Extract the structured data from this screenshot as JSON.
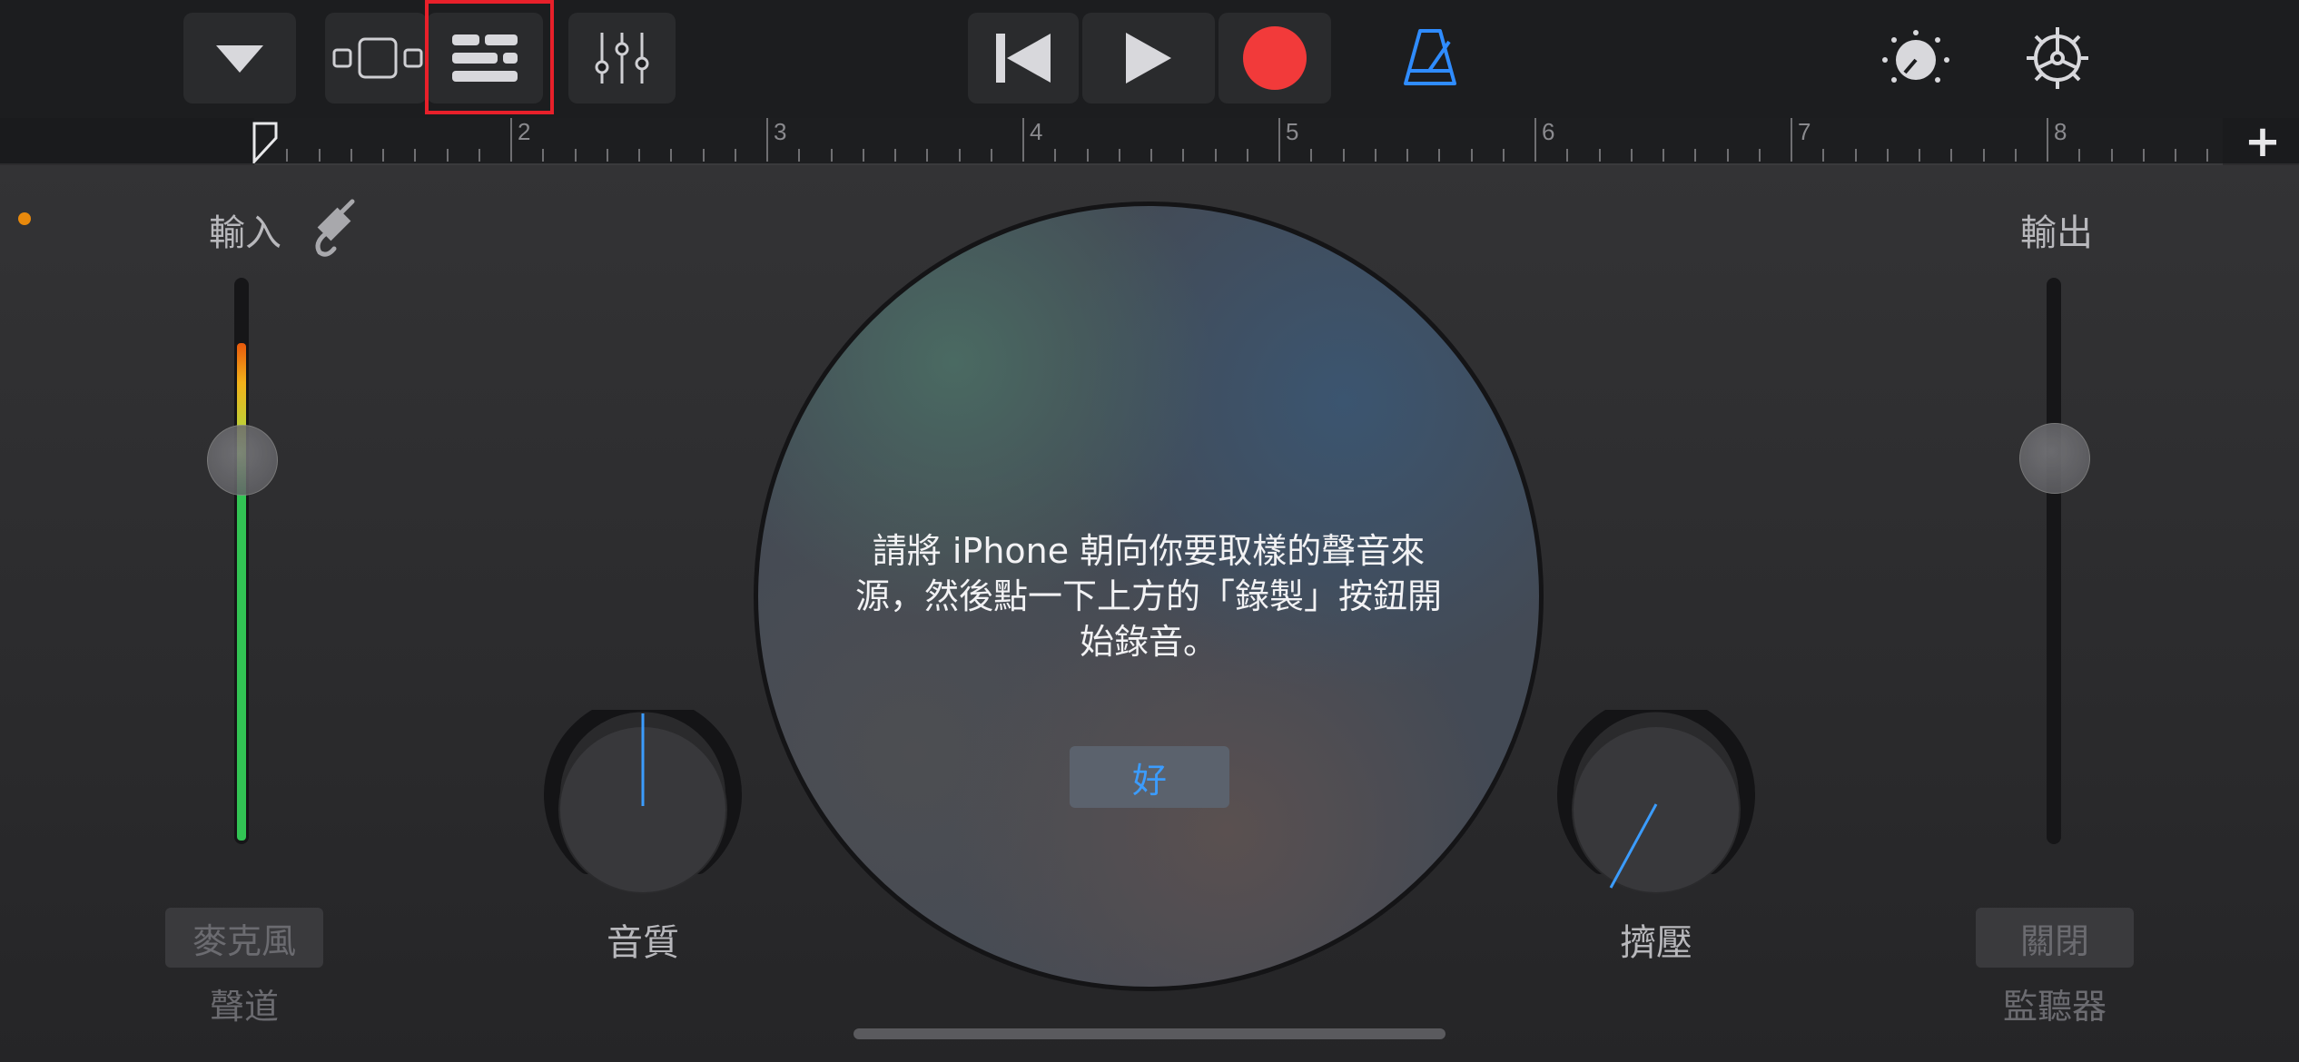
{
  "toolbar": {
    "icons": [
      "chevron-down-icon",
      "tracks-view-icon",
      "browser-view-icon",
      "mixer-icon",
      "rewind-icon",
      "play-icon",
      "record-icon",
      "metronome-icon",
      "master-knob-icon",
      "settings-gear-icon",
      "add-section-icon"
    ],
    "record_color": "#f23a3a",
    "metronome_color": "#2f8cff",
    "highlight_color": "#e8202a"
  },
  "ruler": {
    "bars": [
      "2",
      "3",
      "4",
      "5",
      "6",
      "7",
      "8"
    ],
    "add_label": "+"
  },
  "input": {
    "label": "輸入",
    "channel_button": "麥克風",
    "channel_caption": "聲道",
    "level_fraction": 0.89
  },
  "output": {
    "label": "輸出",
    "monitor_button": "關閉",
    "monitor_caption": "監聽器"
  },
  "knobs": {
    "quality_label": "音質",
    "compress_label": "擠壓"
  },
  "dialog": {
    "message": "請將 iPhone 朝向你要取樣的聲音來源，然後點一下上方的「錄製」按鈕開始錄音。",
    "ok_label": "好"
  },
  "colors": {
    "accent_blue": "#3b9cff",
    "status_dot": "#e8890c"
  }
}
